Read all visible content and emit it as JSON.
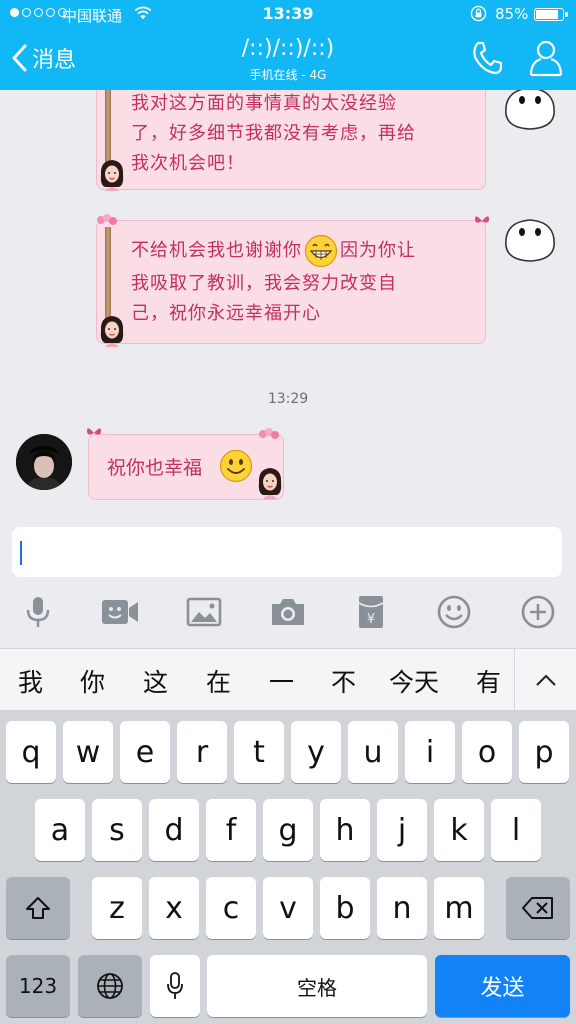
{
  "status_bar": {
    "carrier": "中国联通",
    "time": "13:39",
    "battery": "85%"
  },
  "nav": {
    "back_label": "消息",
    "title": "/::)/::)/::)",
    "subtitle": "手机在线 - 4G"
  },
  "messages": {
    "msg1_lines": [
      "我对这方面的事情真的太没经验",
      "了，好多细节我都没有考虑，再给",
      "我次机会吧！"
    ],
    "msg2_line1_a": "不给机会我也谢谢你",
    "msg2_line1_b": "因为你让",
    "msg2_line2": "我吸取了教训，我会努力改变自",
    "msg2_line3": "己，祝你永远幸福开心",
    "timestamp": "13:29",
    "reply": "祝你也幸福"
  },
  "toolbar": {
    "icons": [
      "microphone-icon",
      "video-icon",
      "image-icon",
      "camera-icon",
      "red-packet-icon",
      "emoji-icon",
      "plus-icon"
    ],
    "red_packet_symbol": "¥"
  },
  "candidates": [
    "我",
    "你",
    "这",
    "在",
    "一",
    "不",
    "今天",
    "有"
  ],
  "keyboard": {
    "row1": [
      "q",
      "w",
      "e",
      "r",
      "t",
      "y",
      "u",
      "i",
      "o",
      "p"
    ],
    "row2": [
      "a",
      "s",
      "d",
      "f",
      "g",
      "h",
      "j",
      "k",
      "l"
    ],
    "row3": [
      "z",
      "x",
      "c",
      "v",
      "b",
      "n",
      "m"
    ],
    "num_label": "123",
    "space_label": "空格",
    "send_label": "发送"
  },
  "colors": {
    "nav_bg": "#12b7f5",
    "bubble_bg": "#fbdde6",
    "bubble_text": "#c22f63",
    "send_key": "#1283f6"
  }
}
